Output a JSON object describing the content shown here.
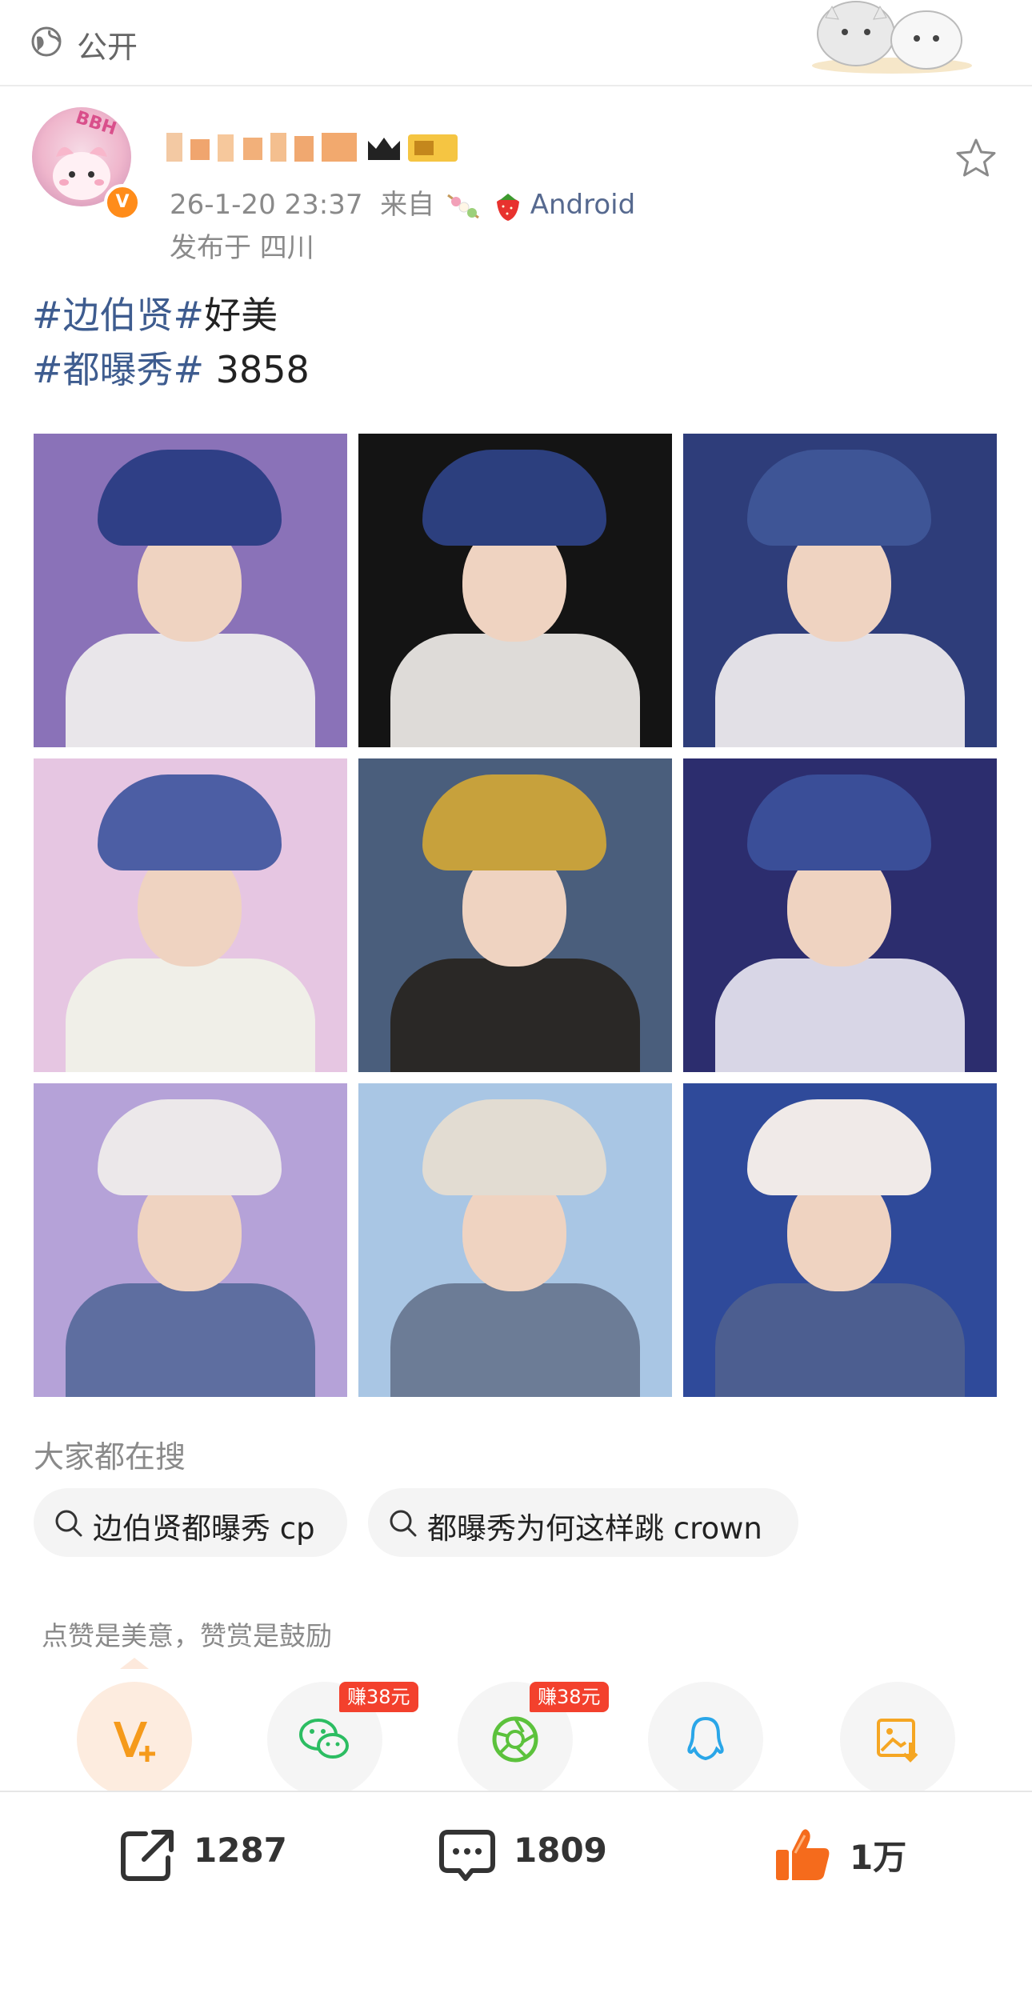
{
  "visibility": {
    "icon": "globe-icon",
    "label": "公开"
  },
  "post": {
    "author": {
      "avatar_text": "BBH",
      "verified_badge": "V"
    },
    "timestamp": "26-1-20 23:37",
    "source_prefix": "来自",
    "source_device": "Android",
    "location": "发布于 四川",
    "text": {
      "line1_tag": "#边伯贤#",
      "line1_rest": "好美",
      "line2_tag": "#都曝秀#",
      "line2_rest": " 3858"
    }
  },
  "photos": [
    {
      "name": "photo-1",
      "bg": "#8a72b8",
      "hat": "#2f3f86",
      "body": "#e9e6ea"
    },
    {
      "name": "photo-2",
      "bg": "#141414",
      "hat": "#2c3f7e",
      "body": "#dedbd8"
    },
    {
      "name": "photo-3",
      "bg": "#2e3d7a",
      "hat": "#3e5596",
      "body": "#e2e0e6"
    },
    {
      "name": "photo-4",
      "bg": "#e6c6e2",
      "hat": "#4c5ea4",
      "body": "#f0efe8"
    },
    {
      "name": "photo-5",
      "bg": "#4a5e7c",
      "hat": "#c7a13c",
      "body": "#2a2826"
    },
    {
      "name": "photo-6",
      "bg": "#2c2d6e",
      "hat": "#3a4e98",
      "body": "#d8d6e6"
    },
    {
      "name": "photo-7",
      "bg": "#b5a2d8",
      "hat": "#ece8ea",
      "body": "#5e6ea0"
    },
    {
      "name": "photo-8",
      "bg": "#a9c6e4",
      "hat": "#e2dcd2",
      "body": "#6c7c96"
    },
    {
      "name": "photo-9",
      "bg": "#2f4a9a",
      "hat": "#f0eae8",
      "body": "#4c5e90"
    }
  ],
  "trending": {
    "title": "大家都在搜",
    "items": [
      {
        "label": "边伯贤都曝秀 cp"
      },
      {
        "label": "都曝秀为何这样跳 crown"
      }
    ]
  },
  "reward": {
    "title": "点赞是美意，赞赏是鼓励",
    "buttons": [
      {
        "name": "vplus-reward-button",
        "icon": "vplus-icon"
      },
      {
        "name": "wechat-share-button",
        "icon": "wechat-icon",
        "badge": "赚38元"
      },
      {
        "name": "moments-share-button",
        "icon": "moments-aperture-icon",
        "badge": "赚38元"
      },
      {
        "name": "qq-share-button",
        "icon": "qq-icon"
      },
      {
        "name": "save-image-button",
        "icon": "save-image-icon"
      }
    ]
  },
  "actions": {
    "repost_count": "1287",
    "comment_count": "1809",
    "like_count": "1万"
  },
  "colors": {
    "link": "#3e5c8f",
    "meta": "#8a8a8a",
    "verified": "#ff8c1a",
    "badge_red": "#f3412d",
    "like_orange": "#f56b1c"
  }
}
